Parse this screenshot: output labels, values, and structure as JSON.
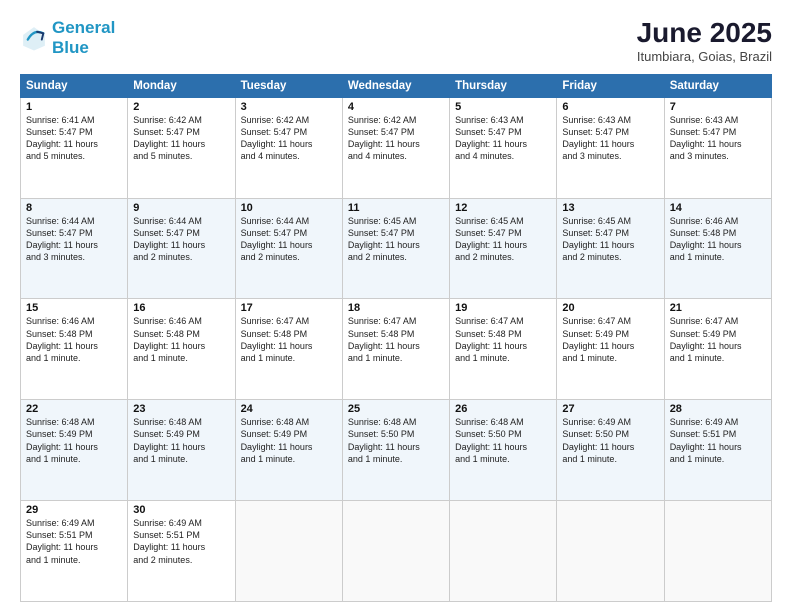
{
  "header": {
    "logo_line1": "General",
    "logo_line2": "Blue",
    "month_year": "June 2025",
    "location": "Itumbiara, Goias, Brazil"
  },
  "weekdays": [
    "Sunday",
    "Monday",
    "Tuesday",
    "Wednesday",
    "Thursday",
    "Friday",
    "Saturday"
  ],
  "weeks": [
    [
      {
        "day": "1",
        "lines": [
          "Sunrise: 6:41 AM",
          "Sunset: 5:47 PM",
          "Daylight: 11 hours",
          "and 5 minutes."
        ]
      },
      {
        "day": "2",
        "lines": [
          "Sunrise: 6:42 AM",
          "Sunset: 5:47 PM",
          "Daylight: 11 hours",
          "and 5 minutes."
        ]
      },
      {
        "day": "3",
        "lines": [
          "Sunrise: 6:42 AM",
          "Sunset: 5:47 PM",
          "Daylight: 11 hours",
          "and 4 minutes."
        ]
      },
      {
        "day": "4",
        "lines": [
          "Sunrise: 6:42 AM",
          "Sunset: 5:47 PM",
          "Daylight: 11 hours",
          "and 4 minutes."
        ]
      },
      {
        "day": "5",
        "lines": [
          "Sunrise: 6:43 AM",
          "Sunset: 5:47 PM",
          "Daylight: 11 hours",
          "and 4 minutes."
        ]
      },
      {
        "day": "6",
        "lines": [
          "Sunrise: 6:43 AM",
          "Sunset: 5:47 PM",
          "Daylight: 11 hours",
          "and 3 minutes."
        ]
      },
      {
        "day": "7",
        "lines": [
          "Sunrise: 6:43 AM",
          "Sunset: 5:47 PM",
          "Daylight: 11 hours",
          "and 3 minutes."
        ]
      }
    ],
    [
      {
        "day": "8",
        "lines": [
          "Sunrise: 6:44 AM",
          "Sunset: 5:47 PM",
          "Daylight: 11 hours",
          "and 3 minutes."
        ]
      },
      {
        "day": "9",
        "lines": [
          "Sunrise: 6:44 AM",
          "Sunset: 5:47 PM",
          "Daylight: 11 hours",
          "and 2 minutes."
        ]
      },
      {
        "day": "10",
        "lines": [
          "Sunrise: 6:44 AM",
          "Sunset: 5:47 PM",
          "Daylight: 11 hours",
          "and 2 minutes."
        ]
      },
      {
        "day": "11",
        "lines": [
          "Sunrise: 6:45 AM",
          "Sunset: 5:47 PM",
          "Daylight: 11 hours",
          "and 2 minutes."
        ]
      },
      {
        "day": "12",
        "lines": [
          "Sunrise: 6:45 AM",
          "Sunset: 5:47 PM",
          "Daylight: 11 hours",
          "and 2 minutes."
        ]
      },
      {
        "day": "13",
        "lines": [
          "Sunrise: 6:45 AM",
          "Sunset: 5:47 PM",
          "Daylight: 11 hours",
          "and 2 minutes."
        ]
      },
      {
        "day": "14",
        "lines": [
          "Sunrise: 6:46 AM",
          "Sunset: 5:48 PM",
          "Daylight: 11 hours",
          "and 1 minute."
        ]
      }
    ],
    [
      {
        "day": "15",
        "lines": [
          "Sunrise: 6:46 AM",
          "Sunset: 5:48 PM",
          "Daylight: 11 hours",
          "and 1 minute."
        ]
      },
      {
        "day": "16",
        "lines": [
          "Sunrise: 6:46 AM",
          "Sunset: 5:48 PM",
          "Daylight: 11 hours",
          "and 1 minute."
        ]
      },
      {
        "day": "17",
        "lines": [
          "Sunrise: 6:47 AM",
          "Sunset: 5:48 PM",
          "Daylight: 11 hours",
          "and 1 minute."
        ]
      },
      {
        "day": "18",
        "lines": [
          "Sunrise: 6:47 AM",
          "Sunset: 5:48 PM",
          "Daylight: 11 hours",
          "and 1 minute."
        ]
      },
      {
        "day": "19",
        "lines": [
          "Sunrise: 6:47 AM",
          "Sunset: 5:48 PM",
          "Daylight: 11 hours",
          "and 1 minute."
        ]
      },
      {
        "day": "20",
        "lines": [
          "Sunrise: 6:47 AM",
          "Sunset: 5:49 PM",
          "Daylight: 11 hours",
          "and 1 minute."
        ]
      },
      {
        "day": "21",
        "lines": [
          "Sunrise: 6:47 AM",
          "Sunset: 5:49 PM",
          "Daylight: 11 hours",
          "and 1 minute."
        ]
      }
    ],
    [
      {
        "day": "22",
        "lines": [
          "Sunrise: 6:48 AM",
          "Sunset: 5:49 PM",
          "Daylight: 11 hours",
          "and 1 minute."
        ]
      },
      {
        "day": "23",
        "lines": [
          "Sunrise: 6:48 AM",
          "Sunset: 5:49 PM",
          "Daylight: 11 hours",
          "and 1 minute."
        ]
      },
      {
        "day": "24",
        "lines": [
          "Sunrise: 6:48 AM",
          "Sunset: 5:49 PM",
          "Daylight: 11 hours",
          "and 1 minute."
        ]
      },
      {
        "day": "25",
        "lines": [
          "Sunrise: 6:48 AM",
          "Sunset: 5:50 PM",
          "Daylight: 11 hours",
          "and 1 minute."
        ]
      },
      {
        "day": "26",
        "lines": [
          "Sunrise: 6:48 AM",
          "Sunset: 5:50 PM",
          "Daylight: 11 hours",
          "and 1 minute."
        ]
      },
      {
        "day": "27",
        "lines": [
          "Sunrise: 6:49 AM",
          "Sunset: 5:50 PM",
          "Daylight: 11 hours",
          "and 1 minute."
        ]
      },
      {
        "day": "28",
        "lines": [
          "Sunrise: 6:49 AM",
          "Sunset: 5:51 PM",
          "Daylight: 11 hours",
          "and 1 minute."
        ]
      }
    ],
    [
      {
        "day": "29",
        "lines": [
          "Sunrise: 6:49 AM",
          "Sunset: 5:51 PM",
          "Daylight: 11 hours",
          "and 1 minute."
        ]
      },
      {
        "day": "30",
        "lines": [
          "Sunrise: 6:49 AM",
          "Sunset: 5:51 PM",
          "Daylight: 11 hours",
          "and 2 minutes."
        ]
      },
      {
        "day": "",
        "lines": []
      },
      {
        "day": "",
        "lines": []
      },
      {
        "day": "",
        "lines": []
      },
      {
        "day": "",
        "lines": []
      },
      {
        "day": "",
        "lines": []
      }
    ]
  ]
}
